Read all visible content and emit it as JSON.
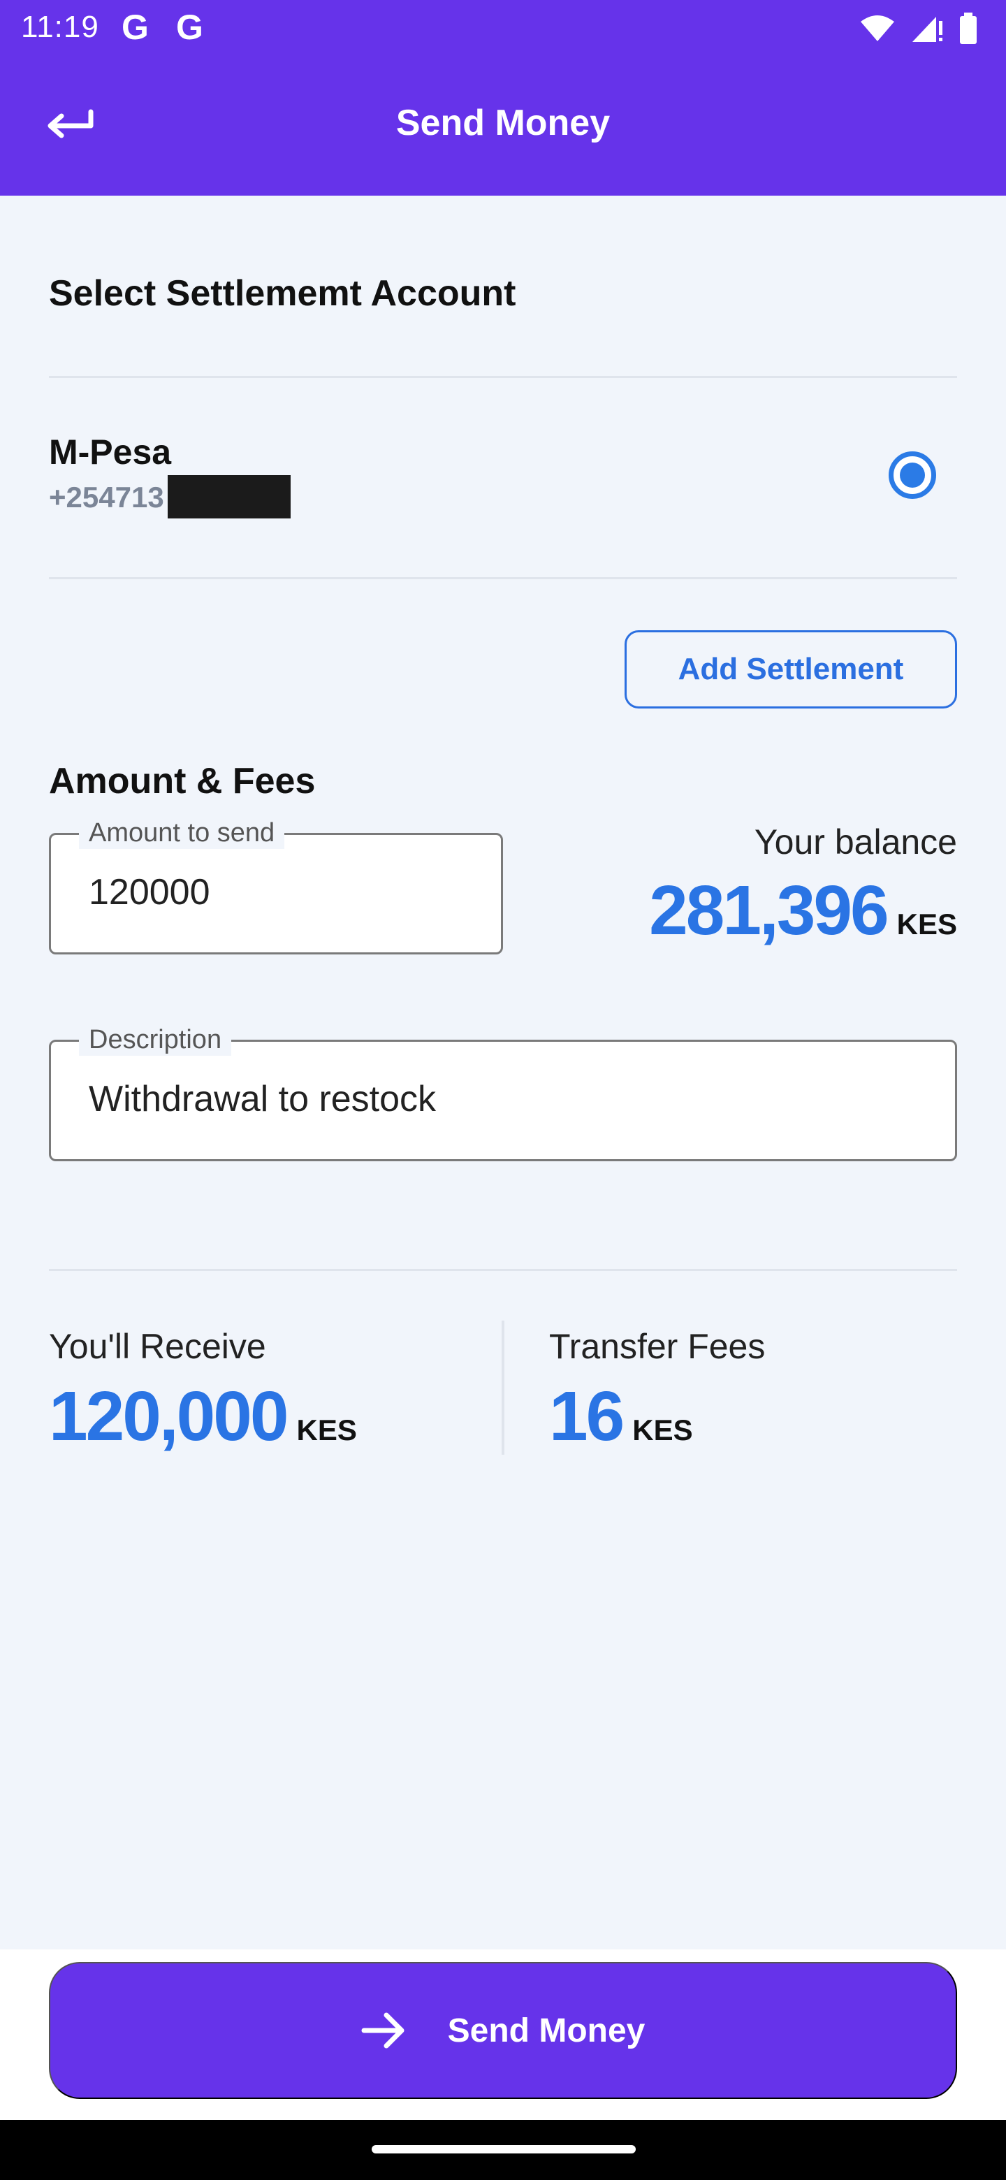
{
  "status_bar": {
    "time": "11:19",
    "g1": "G",
    "g2": "G"
  },
  "app_bar": {
    "title": "Send Money"
  },
  "settlement": {
    "title": "Select Settlememt Account",
    "account_name": "M-Pesa",
    "account_phone": "+254713",
    "add_button": "Add Settlement"
  },
  "amount_fees": {
    "title": "Amount & Fees",
    "amount_label": "Amount to send",
    "amount_value": "120000",
    "balance_label": "Your balance",
    "balance_value": "281,396",
    "balance_unit": "KES",
    "description_label": "Description",
    "description_value": "Withdrawal to restock"
  },
  "summary": {
    "receive_label": "You'll Receive",
    "receive_value": "120,000",
    "receive_unit": "KES",
    "fees_label": "Transfer Fees",
    "fees_value": "16",
    "fees_unit": "KES"
  },
  "footer": {
    "send_button": "Send Money"
  },
  "colors": {
    "primary": "#6633ea",
    "accent_blue": "#2a74e4",
    "background": "#f1f5fb"
  }
}
